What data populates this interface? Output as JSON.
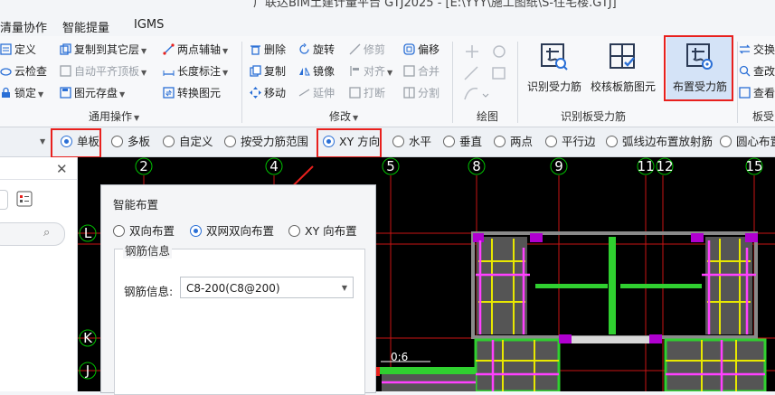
{
  "window": {
    "title_fragment": "广联达BIM土建计量平台 GTJ2025 - [E:\\YYY\\施工图纸\\S-住宅楼.GTJ]"
  },
  "menu": [
    "清量协作",
    "智能提量",
    "IGMS"
  ],
  "ribbon": {
    "general": {
      "items": [
        "定义",
        "复制到其它层",
        "两点辅轴",
        "云检查",
        "自动平齐顶板",
        "长度标注",
        "锁定",
        "图元存盘",
        "转换图元"
      ],
      "group_label": "通用操作"
    },
    "modify": {
      "items": [
        "删除",
        "旋转",
        "修剪",
        "偏移",
        "复制",
        "镜像",
        "对齐",
        "合并",
        "移动",
        "延伸",
        "打断",
        "分割"
      ],
      "group_label": "修改"
    },
    "draw": {
      "group_label": "绘图"
    },
    "identify": {
      "buttons": [
        "识别受力筋",
        "校核板筋图元",
        "布置受力筋"
      ],
      "group_label": "识别板受力筋"
    },
    "right": {
      "items": [
        "交换",
        "查改",
        "查看"
      ],
      "group_label": "板受"
    }
  },
  "options": {
    "mode": [
      {
        "label": "单板",
        "selected": true
      },
      {
        "label": "多板",
        "selected": false
      },
      {
        "label": "自定义",
        "selected": false
      },
      {
        "label": "按受力筋范围",
        "selected": false
      }
    ],
    "direction": [
      {
        "label": "XY 方向",
        "selected": true
      },
      {
        "label": "水平",
        "selected": false
      },
      {
        "label": "垂直",
        "selected": false
      },
      {
        "label": "两点",
        "selected": false
      },
      {
        "label": "平行边",
        "selected": false
      },
      {
        "label": "弧线边布置放射筋",
        "selected": false
      },
      {
        "label": "圆心布置",
        "selected": false
      }
    ]
  },
  "grid": {
    "columns": [
      "2",
      "4",
      "5",
      "8",
      "9",
      "11",
      "12",
      "15"
    ],
    "rows": [
      "L",
      "K",
      "J"
    ],
    "annotation": "0;6"
  },
  "dialog": {
    "title": "智能布置",
    "layout_options": [
      {
        "label": "双向布置",
        "selected": false
      },
      {
        "label": "双网双向布置",
        "selected": true
      },
      {
        "label": "XY 向布置",
        "selected": false
      }
    ],
    "section": "钢筋信息",
    "field_label": "钢筋信息:",
    "field_value": "C8-200(C8@200)"
  },
  "colors": {
    "highlight": "#e8201d",
    "accent": "#2a6fd6",
    "canvas_bg": "#000000",
    "grid_green": "#00c000"
  }
}
